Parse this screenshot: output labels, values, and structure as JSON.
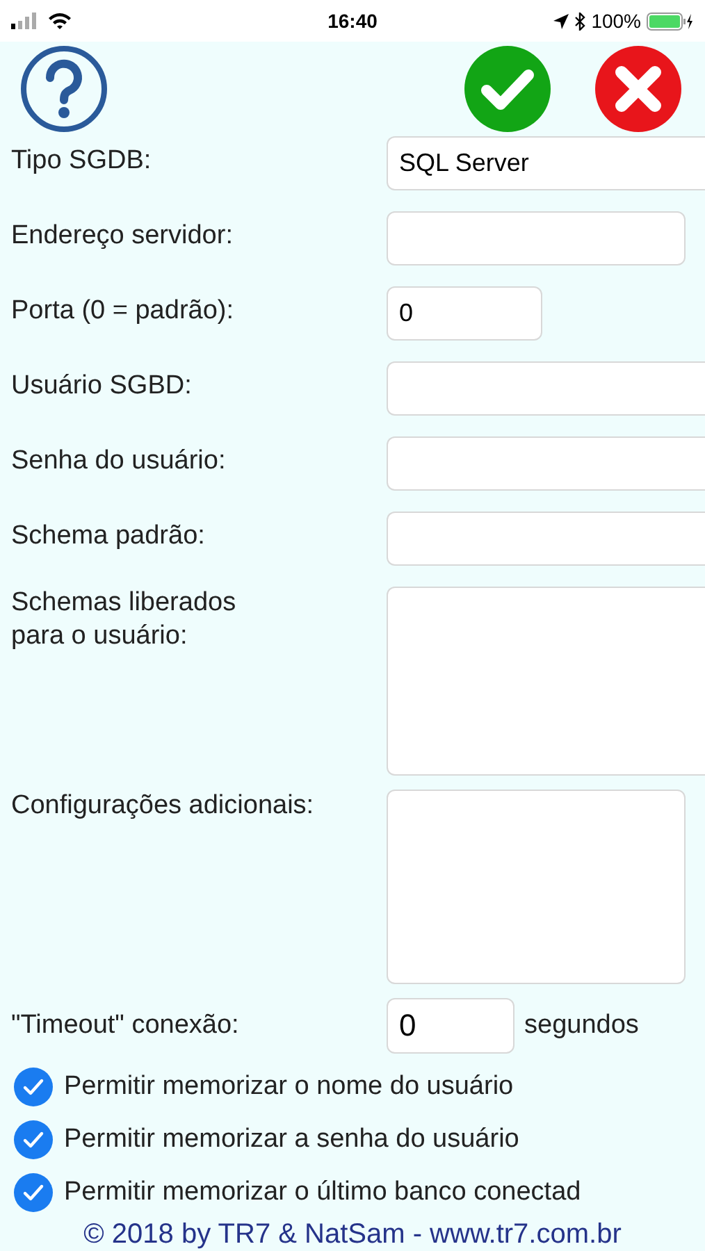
{
  "status_bar": {
    "time": "16:40",
    "battery": "100%"
  },
  "fields": [
    {
      "label": "Tipo SGDB:",
      "value": "SQL Server",
      "kind": "select"
    },
    {
      "label": "Endereço servidor:",
      "kind": "input"
    },
    {
      "label": "Porta (0 = padrão):",
      "value": "0",
      "kind": "input"
    },
    {
      "label": "Usuário SGBD:",
      "kind": "input"
    },
    {
      "label": "Senha do usuário:",
      "kind": "input"
    },
    {
      "label": "Schema padrão:",
      "kind": "input"
    },
    {
      "label": "Schemas liberados para o usuário:",
      "kind": "textarea"
    },
    {
      "label": "Configurações adicionais:",
      "kind": "textarea"
    }
  ],
  "timeout": {
    "label": "\"Timeout\" conexão:",
    "value": "0",
    "unit": "segundos"
  },
  "options": [
    {
      "label": "Permitir memorizar o nome do usuário",
      "checked": true
    },
    {
      "label": "Permitir memorizar a senha do usuário",
      "checked": true
    },
    {
      "label": "Permitir memorizar o último banco conectad",
      "checked": true
    }
  ],
  "footer": "© 2018 by TR7 & NatSam - www.tr7.com.br"
}
